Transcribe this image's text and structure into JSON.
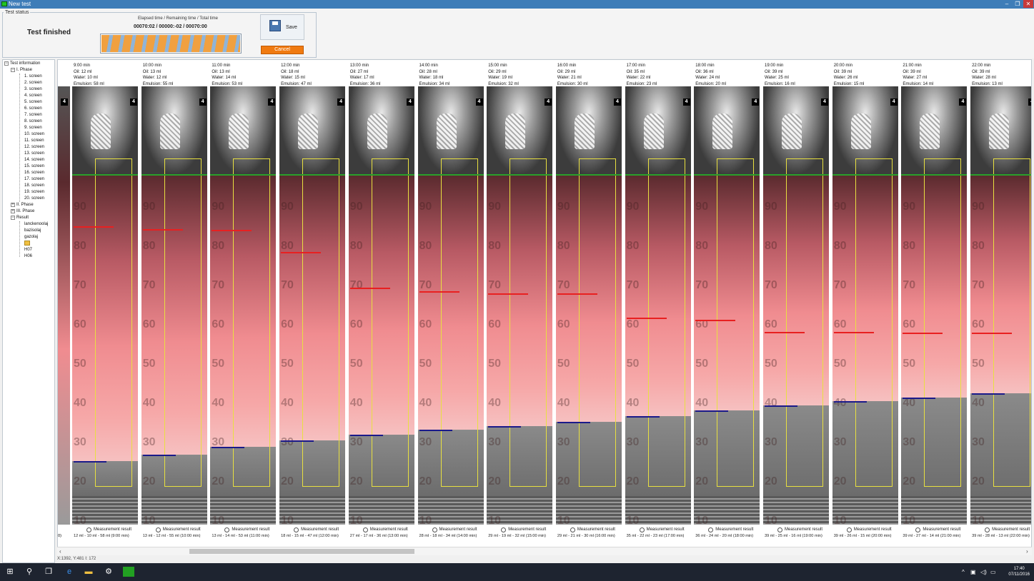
{
  "window": {
    "title": "New test",
    "minimize": "–",
    "maximize": "❐",
    "close": "✕"
  },
  "status": {
    "group_label": "Test status",
    "state_text": "Test finished",
    "time_label": "Elapsed time / Remaining time / Total time",
    "time_value": "00070:02 / 00000:-02 / 00070:00",
    "progress": 1.0,
    "save_label": "Save",
    "cancel_label": "Cancel"
  },
  "tree": {
    "root": "Test information",
    "phase1": "I. Phase",
    "screens": [
      "1. screen",
      "2. screen",
      "3. screen",
      "4. screen",
      "5. screen",
      "6. screen",
      "7. screen",
      "8. screen",
      "9. screen",
      "10. screen",
      "11. screen",
      "12. screen",
      "13. screen",
      "14. screen",
      "15. screen",
      "16. screen",
      "17. screen",
      "18. screen",
      "19. screen",
      "20. screen"
    ],
    "phase2": "II. Phase",
    "phase3": "III. Phase",
    "result": "Result",
    "result_items": [
      "lanckenoolaj",
      "bazisolaj",
      "gazolaj"
    ],
    "h_items": [
      "H07",
      "H06"
    ]
  },
  "viewer": {
    "badge": "4",
    "measurement_label": "Measurement result",
    "oil_prefix": "Oil:",
    "water_prefix": "Water:",
    "emulsion_prefix": "Emulsion:",
    "partial_summary": "0)",
    "ruler_marks": [
      "90",
      "80",
      "70",
      "60",
      "50",
      "40",
      "30",
      "20",
      "10"
    ],
    "columns": [
      {
        "time": "9:00 min",
        "oil": "Oil: 12 ml",
        "water": "Water: 10 ml",
        "emulsion": "Emulsion: 58 ml",
        "summary": "12 ml - 10 ml - 58 ml (9:00 min)",
        "red": 0.32,
        "blue": 0.855
      },
      {
        "time": "10:00 min",
        "oil": "Oil: 13 ml",
        "water": "Water: 12 ml",
        "emulsion": "Emulsion: 55 ml",
        "summary": "13 ml - 12 ml - 55 ml (10:00 min)",
        "red": 0.325,
        "blue": 0.84
      },
      {
        "time": "11:00 min",
        "oil": "Oil: 13 ml",
        "water": "Water: 14 ml",
        "emulsion": "Emulsion: 53 ml",
        "summary": "13 ml - 14 ml - 53 ml (11:00 min)",
        "red": 0.327,
        "blue": 0.822
      },
      {
        "time": "12:00 min",
        "oil": "Oil: 18 ml",
        "water": "Water: 15 ml",
        "emulsion": "Emulsion: 47 ml",
        "summary": "18 ml - 15 ml - 47 ml (12:00 min)",
        "red": 0.378,
        "blue": 0.808
      },
      {
        "time": "13:00 min",
        "oil": "Oil: 27 ml",
        "water": "Water: 17 ml",
        "emulsion": "Emulsion: 36 ml",
        "summary": "27 ml - 17 ml - 36 ml (13:00 min)",
        "red": 0.46,
        "blue": 0.795
      },
      {
        "time": "14:00 min",
        "oil": "Oil: 28 ml",
        "water": "Water: 18 ml",
        "emulsion": "Emulsion: 34 ml",
        "summary": "28 ml - 18 ml - 34 ml (14:00 min)",
        "red": 0.467,
        "blue": 0.783
      },
      {
        "time": "15:00 min",
        "oil": "Oil: 29 ml",
        "water": "Water: 19 ml",
        "emulsion": "Emulsion: 32 ml",
        "summary": "29 ml - 19 ml - 32 ml (15:00 min)",
        "red": 0.472,
        "blue": 0.775
      },
      {
        "time": "16:00 min",
        "oil": "Oil: 29 ml",
        "water": "Water: 21 ml",
        "emulsion": "Emulsion: 30 ml",
        "summary": "29 ml - 21 ml - 30 ml (16:00 min)",
        "red": 0.472,
        "blue": 0.765
      },
      {
        "time": "17:00 min",
        "oil": "Oil: 35 ml",
        "water": "Water: 22 ml",
        "emulsion": "Emulsion: 23 ml",
        "summary": "35 ml - 22 ml - 23 ml (17:00 min)",
        "red": 0.528,
        "blue": 0.752
      },
      {
        "time": "18:00 min",
        "oil": "Oil: 36 ml",
        "water": "Water: 24 ml",
        "emulsion": "Emulsion: 20 ml",
        "summary": "36 ml - 24 ml - 20 ml (18:00 min)",
        "red": 0.532,
        "blue": 0.74
      },
      {
        "time": "19:00 min",
        "oil": "Oil: 39 ml",
        "water": "Water: 25 ml",
        "emulsion": "Emulsion: 16 ml",
        "summary": "39 ml - 25 ml - 16 ml (19:00 min)",
        "red": 0.56,
        "blue": 0.728
      },
      {
        "time": "20:00 min",
        "oil": "Oil: 39 ml",
        "water": "Water: 26 ml",
        "emulsion": "Emulsion: 15 ml",
        "summary": "39 ml - 26 ml - 15 ml (20:00 min)",
        "red": 0.56,
        "blue": 0.718
      },
      {
        "time": "21:00 min",
        "oil": "Oil: 39 ml",
        "water": "Water: 27 ml",
        "emulsion": "Emulsion: 14 ml",
        "summary": "39 ml - 27 ml - 14 ml (21:00 min)",
        "red": 0.562,
        "blue": 0.71
      },
      {
        "time": "22:00 min",
        "oil": "Oil: 39 ml",
        "water": "Water: 28 ml",
        "emulsion": "Emulsion: 13 ml",
        "summary": "39 ml - 28 ml - 13 ml (22:00 min)",
        "red": 0.562,
        "blue": 0.7
      }
    ]
  },
  "scroll": {
    "left_arrow": "‹",
    "right_arrow": "›"
  },
  "statusbar": {
    "coords": "X:1392, Y:481  I: 172"
  },
  "taskbar": {
    "start_icon": "windows-icon",
    "time": "17:40",
    "date": "07/11/2016"
  },
  "colors": {
    "accent": "#3e7db8",
    "cancel": "#f07a10",
    "oil_line": "#e82020",
    "water_line": "#1a1a8a",
    "frame": "#e8e040"
  }
}
